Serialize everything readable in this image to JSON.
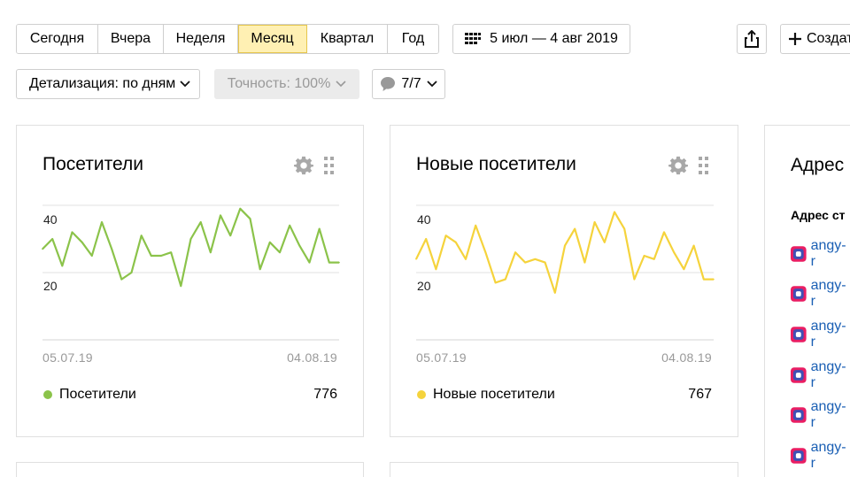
{
  "toolbar": {
    "periods": [
      {
        "label": "Сегодня",
        "active": false
      },
      {
        "label": "Вчера",
        "active": false
      },
      {
        "label": "Неделя",
        "active": false
      },
      {
        "label": "Месяц",
        "active": true
      },
      {
        "label": "Квартал",
        "active": false
      },
      {
        "label": "Год",
        "active": false
      }
    ],
    "date_range": "5 июл — 4 авг 2019",
    "create_label": "Создат",
    "detail_label": "Детализация: по дням",
    "accuracy_label": "Точность: 100%",
    "comments_label": "7/7"
  },
  "widgets": [
    {
      "title": "Посетители",
      "color": "#8bc34a",
      "date_start": "05.07.19",
      "date_end": "04.08.19",
      "legend": "Посетители",
      "total": "776",
      "chart_data": {
        "type": "line",
        "yticks": [
          "40",
          "20"
        ],
        "ylim": [
          0,
          47
        ],
        "values": [
          27,
          30,
          22,
          32,
          29,
          25,
          35,
          27,
          18,
          20,
          31,
          25,
          25,
          26,
          16,
          30,
          35,
          26,
          37,
          31,
          39,
          36,
          21,
          29,
          26,
          34,
          28,
          23,
          33,
          23,
          23
        ]
      }
    },
    {
      "title": "Новые посетители",
      "color": "#f5d33c",
      "date_start": "05.07.19",
      "date_end": "04.08.19",
      "legend": "Новые посетители",
      "total": "767",
      "chart_data": {
        "type": "line",
        "yticks": [
          "40",
          "20"
        ],
        "ylim": [
          0,
          47
        ],
        "values": [
          24,
          30,
          21,
          31,
          29,
          24,
          34,
          26,
          17,
          18,
          26,
          23,
          24,
          23,
          14,
          28,
          33,
          23,
          35,
          29,
          38,
          33,
          18,
          25,
          24,
          32,
          26,
          21,
          28,
          18,
          18
        ]
      }
    }
  ],
  "addresses": {
    "title": "Адрес",
    "column_header": "Адрес ст",
    "items": [
      "angy-r",
      "angy-r",
      "angy-r",
      "angy-r",
      "angy-r",
      "angy-r"
    ]
  }
}
